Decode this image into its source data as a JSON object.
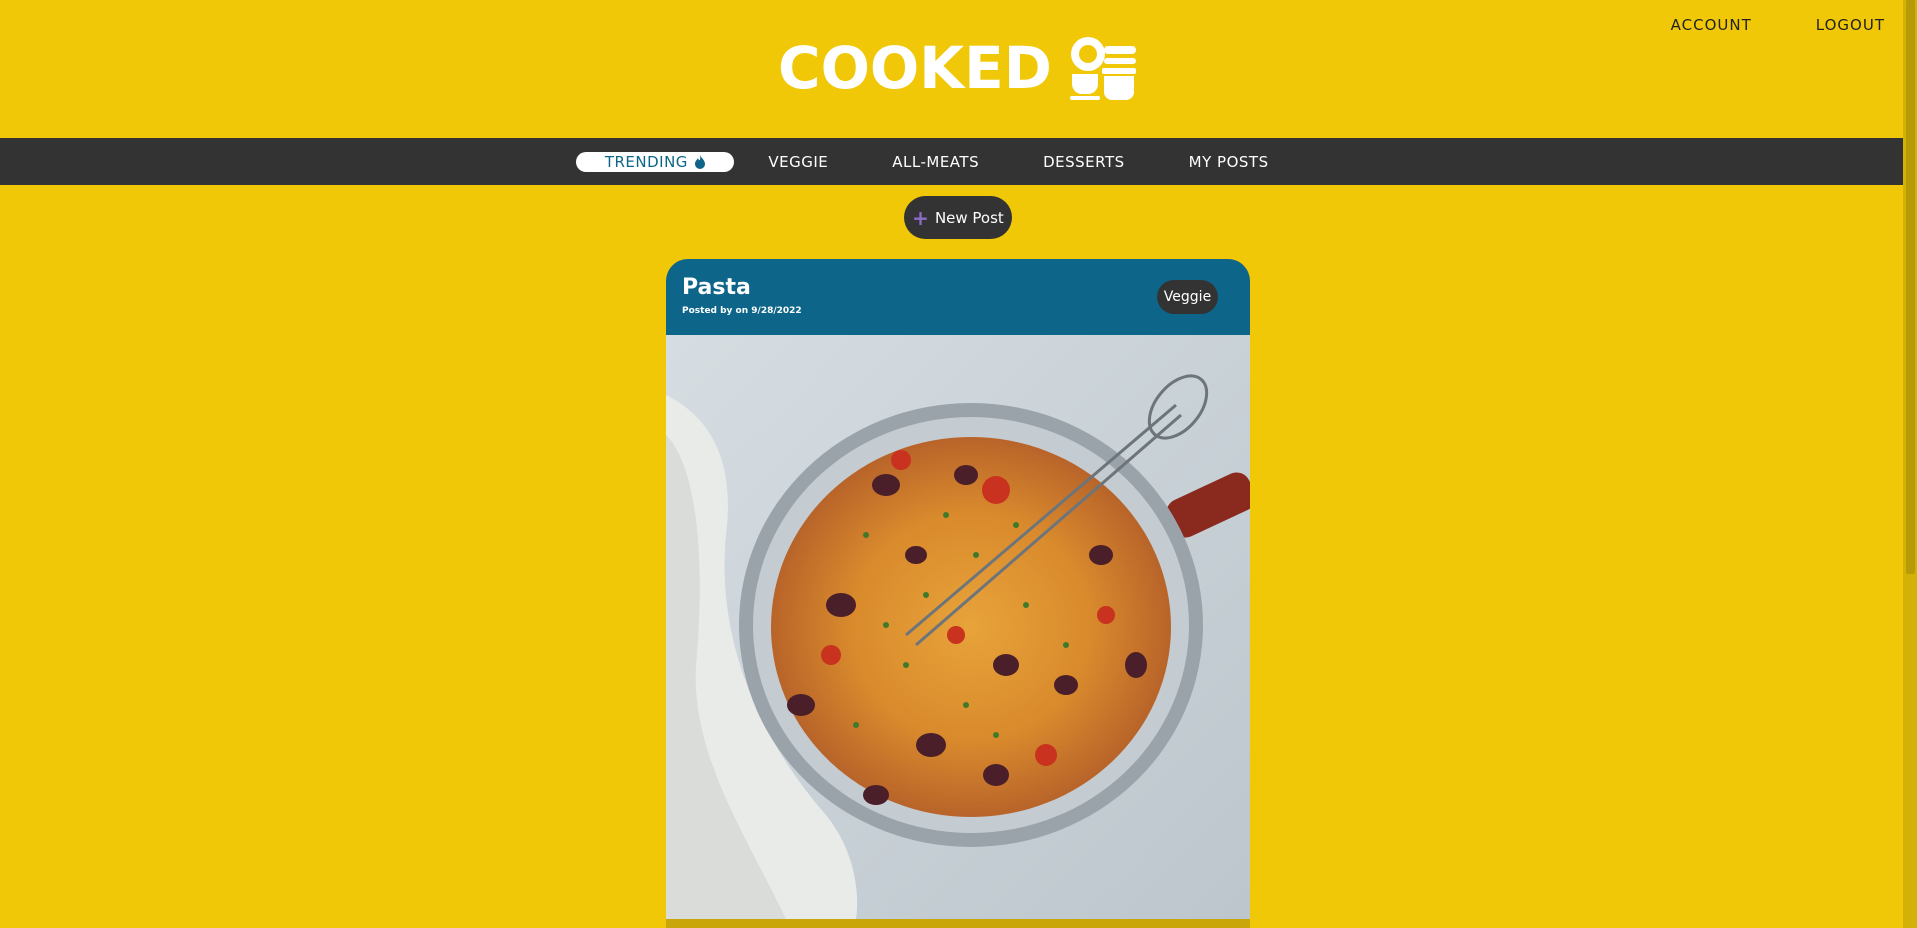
{
  "brand": {
    "name": "COOKED",
    "icon": "cooking-utensils-icon"
  },
  "top_links": [
    "ACCOUNT",
    "LOGOUT"
  ],
  "nav": {
    "items": [
      {
        "label": "TRENDING",
        "active": true,
        "icon": "flame-icon"
      },
      {
        "label": "VEGGIE",
        "active": false
      },
      {
        "label": "ALL-MEATS",
        "active": false
      },
      {
        "label": "DESSERTS",
        "active": false
      },
      {
        "label": "MY POSTS",
        "active": false
      }
    ]
  },
  "new_post": {
    "label": "New Post",
    "icon": "plus-icon"
  },
  "post": {
    "title": "Pasta",
    "meta": "Posted by on 9/28/2022",
    "tag": "Veggie",
    "image": "spaghetti-pan-photo"
  },
  "colors": {
    "background": "#f0c808",
    "navbar": "#333333",
    "card_header": "#0d6689",
    "active_text": "#0d6689"
  }
}
